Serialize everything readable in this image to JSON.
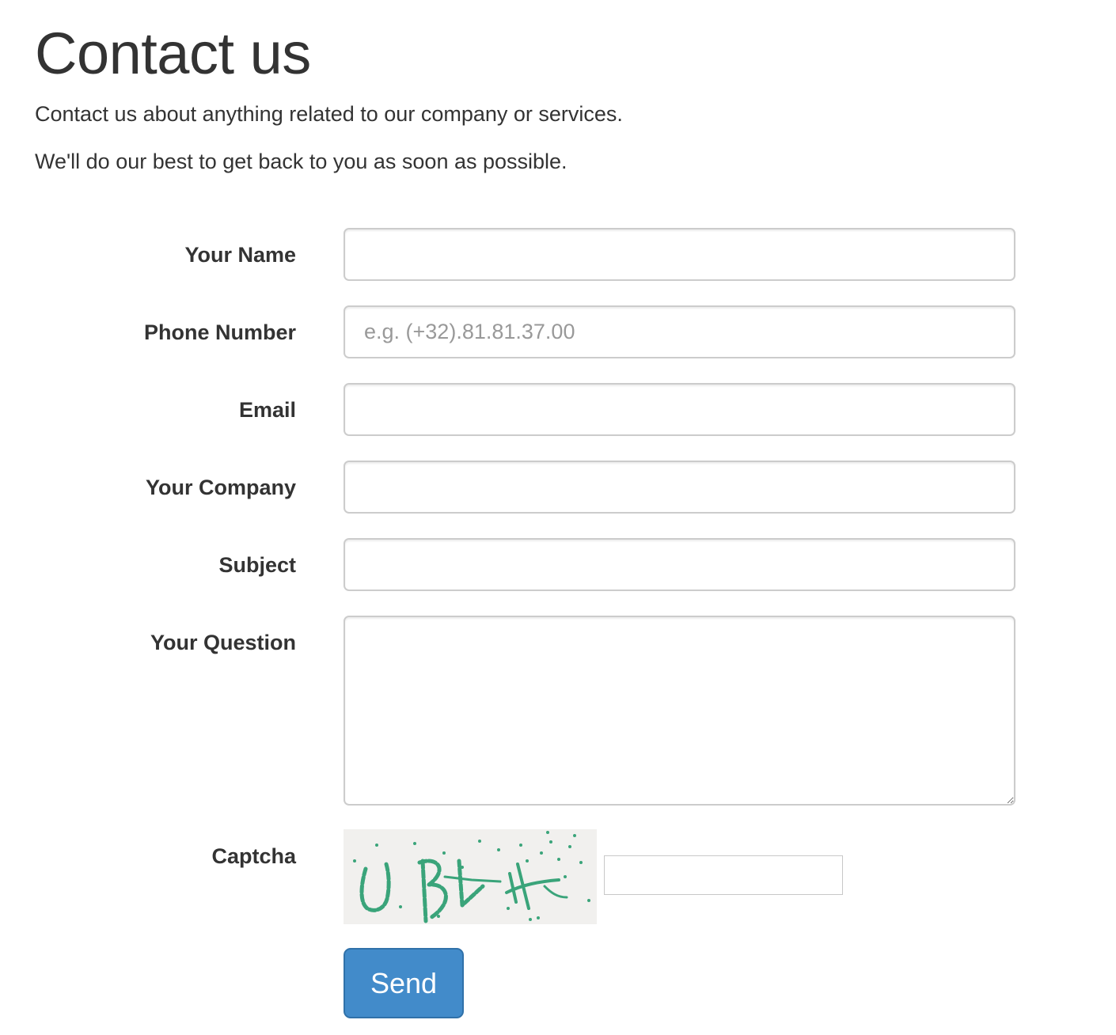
{
  "page": {
    "title": "Contact us",
    "intro_line_1": "Contact us about anything related to our company or services.",
    "intro_line_2": "We'll do our best to get back to you as soon as possible."
  },
  "form": {
    "name": {
      "label": "Your Name",
      "value": "",
      "placeholder": ""
    },
    "phone": {
      "label": "Phone Number",
      "value": "",
      "placeholder": "e.g. (+32).81.81.37.00"
    },
    "email": {
      "label": "Email",
      "value": "",
      "placeholder": ""
    },
    "company": {
      "label": "Your Company",
      "value": "",
      "placeholder": ""
    },
    "subject": {
      "label": "Subject",
      "value": "",
      "placeholder": ""
    },
    "question": {
      "label": "Your Question",
      "value": ""
    },
    "captcha": {
      "label": "Captcha",
      "image_text": "UBV4",
      "value": ""
    },
    "send_label": "Send"
  },
  "colors": {
    "text": "#333333",
    "input_border": "#cccccc",
    "placeholder": "#999999",
    "button_bg": "#428bca",
    "button_border": "#3071a9",
    "captcha_bg": "#f1f0ee",
    "captcha_ink": "#3aa47a"
  }
}
